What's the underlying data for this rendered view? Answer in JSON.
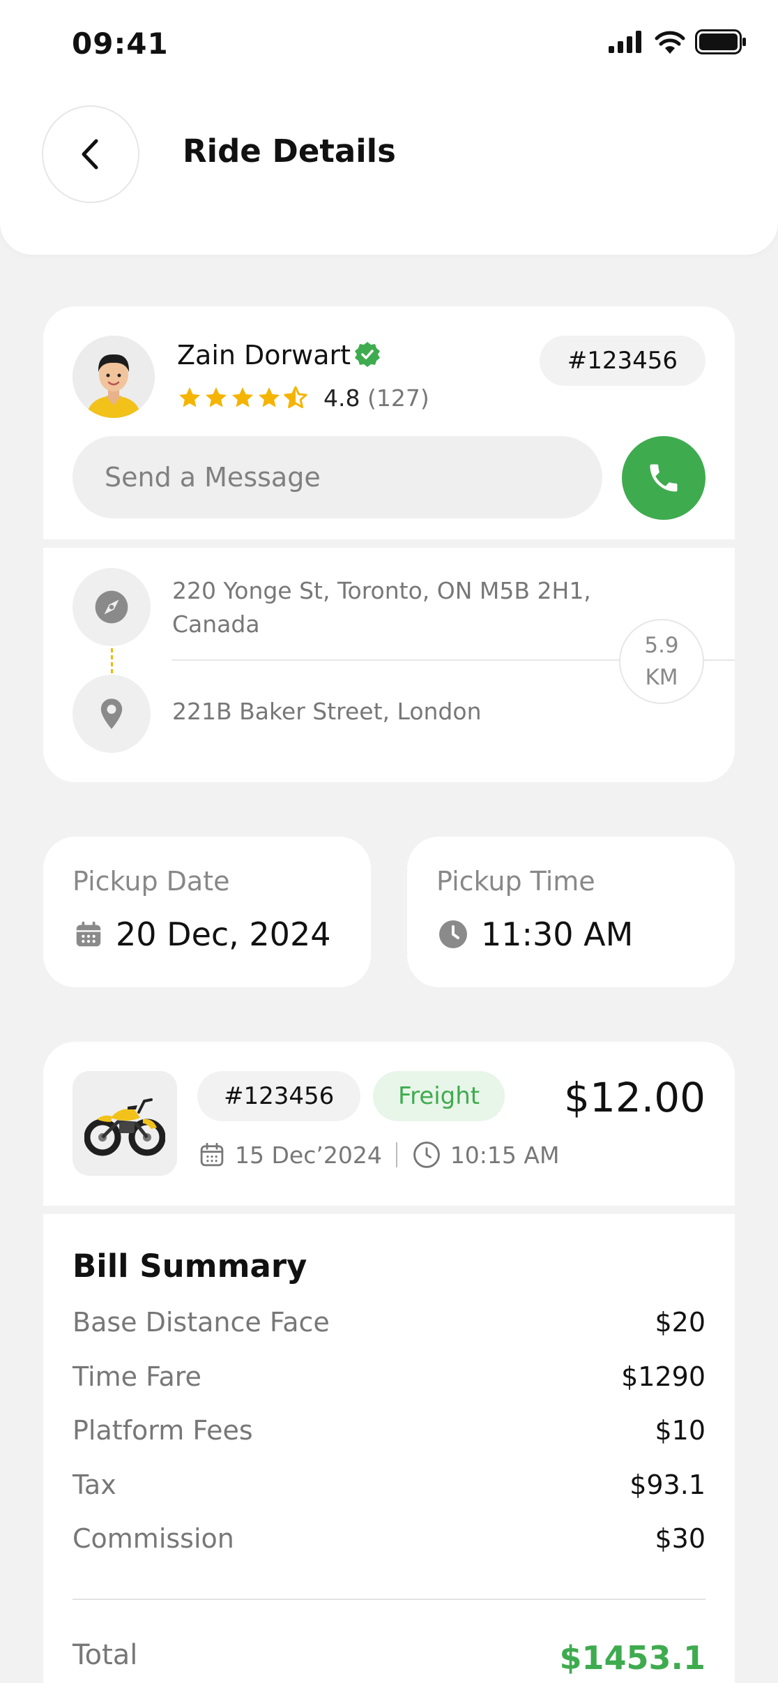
{
  "status_bar": {
    "time": "09:41"
  },
  "header": {
    "title": "Ride Details"
  },
  "driver": {
    "name": "Zain Dorwart",
    "rating": "4.8",
    "reviews": "(127)",
    "ride_id": "#123456",
    "message_placeholder": "Send a Message"
  },
  "route": {
    "from": "220 Yonge St, Toronto, ON M5B 2H1, Canada",
    "to": "221B Baker Street, London",
    "distance_value": "5.9",
    "distance_unit": "KM"
  },
  "pickup": {
    "date_label": "Pickup Date",
    "date_value": "20 Dec, 2024",
    "time_label": "Pickup Time",
    "time_value": "11:30 AM"
  },
  "order": {
    "id": "#123456",
    "type": "Freight",
    "price": "$12.00",
    "date": "15 Dec’2024",
    "time": "10:15 AM"
  },
  "bill": {
    "title": "Bill Summary",
    "rows": [
      {
        "label": "Base Distance Face",
        "value": "$20"
      },
      {
        "label": "Time Fare",
        "value": "$1290"
      },
      {
        "label": "Platform Fees",
        "value": "$10"
      },
      {
        "label": "Tax",
        "value": "$93.1"
      },
      {
        "label": "Commission",
        "value": "$30"
      }
    ],
    "total_label": "Total",
    "total_value": "$1453.1"
  },
  "icons": {
    "back": "chevron-left-icon",
    "verified": "verified-badge-icon",
    "call": "phone-icon",
    "from": "compass-icon",
    "to": "location-pin-icon",
    "date": "calendar-icon",
    "time": "clock-icon",
    "vehicle": "motorbike-icon"
  },
  "colors": {
    "accent_green": "#3fab4f",
    "star": "#f5b400",
    "background": "#f2f2f2"
  }
}
